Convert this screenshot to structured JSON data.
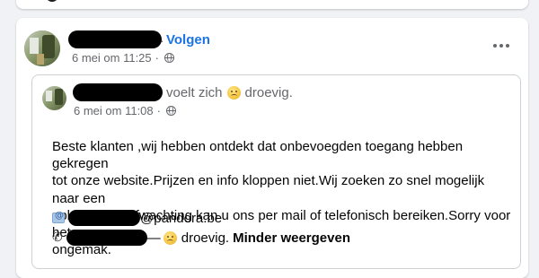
{
  "post": {
    "follow_label": "Volgen",
    "separator": "·",
    "timestamp": "6 mei om 11:25",
    "privacy_icon": "globe-icon",
    "more_icon": "more-options-icon"
  },
  "shared_post": {
    "feeling_text": "voelt zich",
    "feeling_word": "droevig.",
    "feeling_emoji": "sad-face-emoji",
    "timestamp": "6 mei om 11:08",
    "privacy_icon": "globe-icon",
    "body_lines": [
      "Beste klanten ,wij hebben ontdekt dat onbevoegden toegang hebben gekregen",
      "tot onze website.Prijzen en info kloppen niet.Wij zoeken zo snel mogelijk naar een",
      "oplossing.In afwachting kan u ons per mail of telefonisch bereiken.Sorry voor het",
      "ongemak."
    ],
    "email_suffix": "@pandora.be",
    "phone_trail": "—",
    "phone_feeling_word": "droevig.",
    "see_less_label": "Minder weergeven"
  }
}
